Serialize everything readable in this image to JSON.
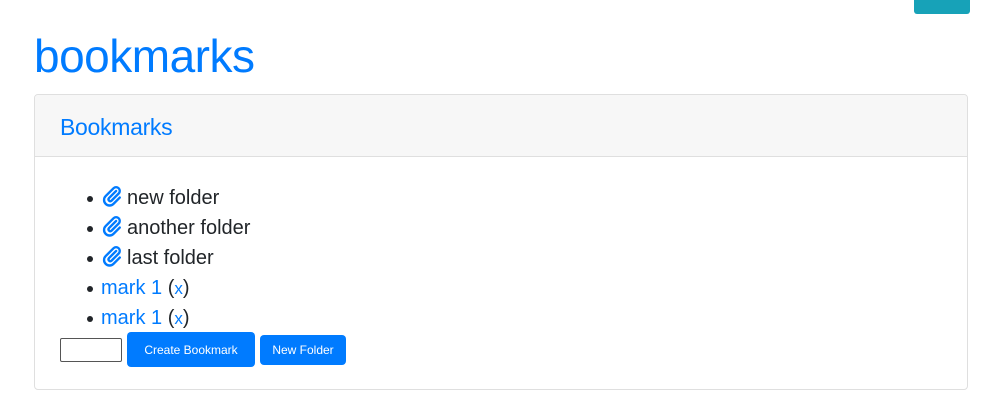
{
  "page": {
    "title": "bookmarks"
  },
  "card": {
    "title": "Bookmarks"
  },
  "folders": [
    {
      "name": "new folder",
      "icon": "paperclip-icon"
    },
    {
      "name": "another folder",
      "icon": "paperclip-icon"
    },
    {
      "name": "last folder",
      "icon": "paperclip-icon"
    }
  ],
  "marks": [
    {
      "name": "mark 1",
      "open": "(",
      "delete": "x",
      "close": ")"
    },
    {
      "name": "mark 1",
      "open": "(",
      "delete": "x",
      "close": ")"
    }
  ],
  "form": {
    "input_value": "",
    "create_label": "Create Bookmark",
    "folder_label": "New Folder"
  },
  "colors": {
    "primary": "#007bff",
    "info": "#17a2b8",
    "text": "#212529",
    "header_bg": "#f7f7f7"
  }
}
